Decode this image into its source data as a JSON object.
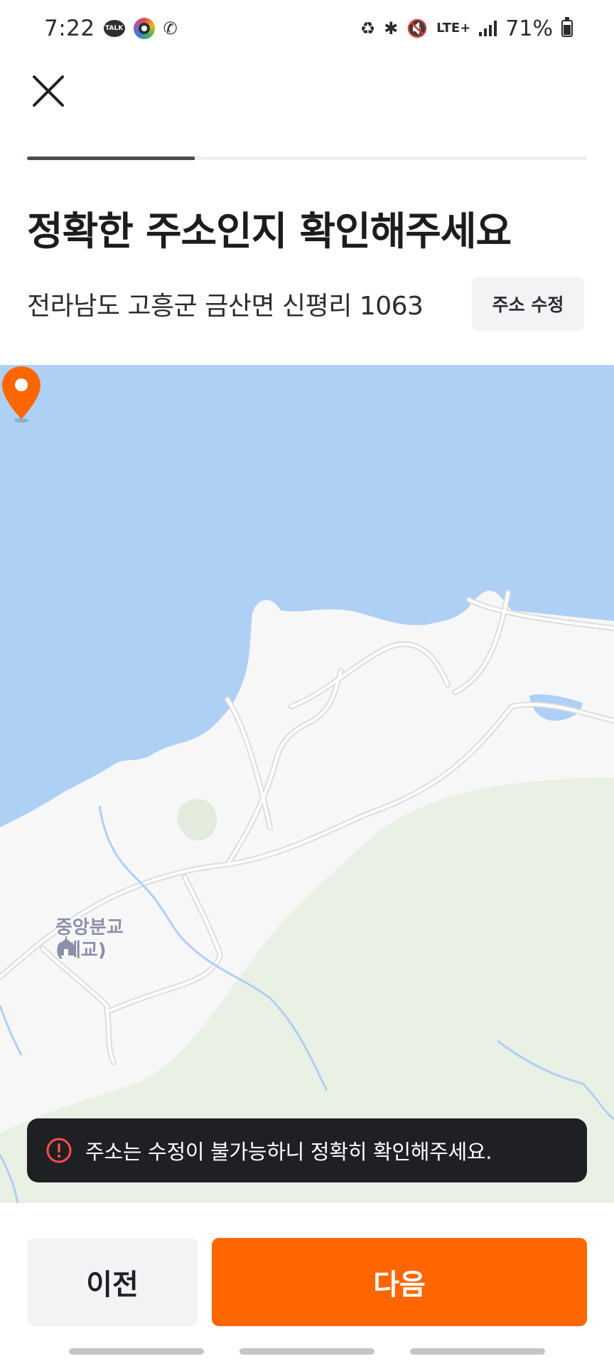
{
  "status_bar": {
    "time": "7:22",
    "talk_label": "TALK",
    "network": "LTE+",
    "battery": "71%"
  },
  "header": {
    "close_icon": "close-icon",
    "progress": 0.3
  },
  "title": "정확한 주소인지 확인해주세요",
  "address": {
    "text": "전라남도 고흥군 금산면 신평리 1063",
    "edit_label": "주소 수정"
  },
  "map": {
    "poi_label": "중앙분교(폐교)",
    "marker_color": "#ff6600",
    "water_color": "#aed0f5",
    "land_color": "#f7f7f7",
    "forest_color": "#e9f1e4"
  },
  "toast": {
    "icon": "alert-circle-icon",
    "text": "주소는 수정이 불가능하니 정확히 확인해주세요."
  },
  "buttons": {
    "prev_label": "이전",
    "next_label": "다음"
  },
  "colors": {
    "accent": "#ff6600",
    "dark": "#1f2024",
    "toast_icon": "#ff4d4d"
  }
}
